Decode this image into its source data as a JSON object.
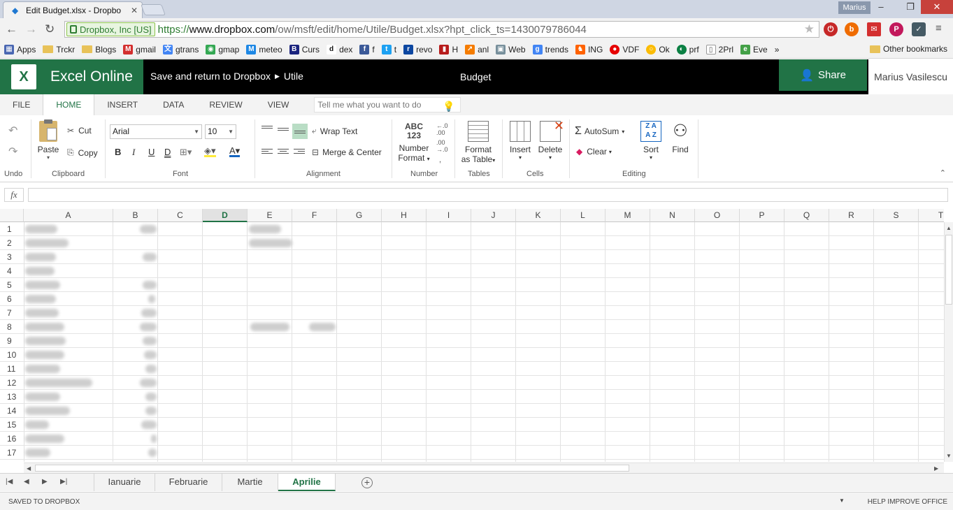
{
  "browser": {
    "tab_title": "Edit Budget.xlsx - Dropbo",
    "user_badge": "Marius",
    "secure_label": "Dropbox, Inc [US]",
    "url_scheme": "https://",
    "url_host": "www.dropbox.com",
    "url_path": "/ow/msft/edit/home/Utile/Budget.xlsx?hpt_click_ts=1430079786044",
    "bookmarks": [
      "Apps",
      "Trckr",
      "Blogs",
      "gmail",
      "gtrans",
      "gmap",
      "meteo",
      "Curs",
      "dex",
      "f",
      "t",
      "revo",
      "H",
      "anl",
      "Web",
      "trends",
      "ING",
      "VDF",
      "Ok",
      "prf",
      "2Prl",
      "Eve"
    ],
    "bookmarks_more": "»",
    "other_bookmarks": "Other bookmarks"
  },
  "office": {
    "app_name": "Excel Online",
    "breadcrumb_back": "Save and return to Dropbox",
    "breadcrumb_folder": "Utile",
    "doc_title": "Budget",
    "share_label": "Share",
    "user_name": "Marius Vasilescu"
  },
  "ribbon_tabs": [
    "FILE",
    "HOME",
    "INSERT",
    "DATA",
    "REVIEW",
    "VIEW"
  ],
  "active_tab": "HOME",
  "tellme_placeholder": "Tell me what you want to do",
  "ribbon": {
    "cut": "Cut",
    "copy": "Copy",
    "paste": "Paste",
    "font_name": "Arial",
    "font_size": "10",
    "wrap_text": "Wrap Text",
    "merge_center": "Merge & Center",
    "number_format_icon": "ABC 123",
    "number_format_l1": "Number",
    "number_format_l2": "Format",
    "format_table_l1": "Format",
    "format_table_l2": "as Table",
    "insert": "Insert",
    "delete": "Delete",
    "autosum": "AutoSum",
    "clear": "Clear",
    "sort": "Sort",
    "find": "Find",
    "groups": [
      "Undo",
      "Clipboard",
      "Font",
      "Alignment",
      "Number",
      "Tables",
      "Cells",
      "Editing"
    ]
  },
  "formula_bar": {
    "fx": "fx",
    "value": ""
  },
  "grid": {
    "columns": [
      "A",
      "B",
      "C",
      "D",
      "E",
      "F",
      "G",
      "H",
      "I",
      "J",
      "K",
      "L",
      "M",
      "N",
      "O",
      "P",
      "Q",
      "R",
      "S",
      "T"
    ],
    "selected_column": "D",
    "rows": [
      "1",
      "2",
      "3",
      "4",
      "5",
      "6",
      "7",
      "8",
      "9",
      "10",
      "11",
      "12",
      "13",
      "14",
      "15",
      "16",
      "17"
    ]
  },
  "sheets": [
    "Ianuarie",
    "Februarie",
    "Martie",
    "Aprilie"
  ],
  "active_sheet": "Aprilie",
  "status": {
    "left": "SAVED TO DROPBOX",
    "right": "HELP IMPROVE OFFICE"
  },
  "colors": {
    "excel_green": "#217346",
    "header_black": "#000000"
  }
}
